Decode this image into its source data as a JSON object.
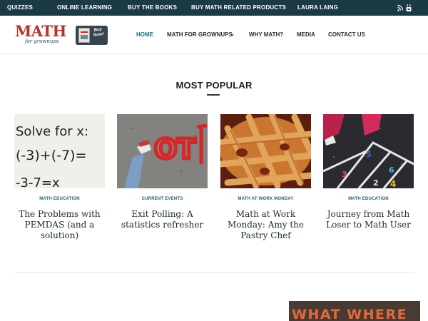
{
  "topbar": {
    "items": [
      "QUIZZES",
      "ONLINE LEARNING",
      "BUY THE BOOKS",
      "BUY MATH RELATED PRODUCTS",
      "LAURA LAING"
    ],
    "social_icons": [
      "rss-icon",
      "youtube-icon"
    ]
  },
  "header": {
    "logo_main": "MATH",
    "logo_sub": "for grownups",
    "book_badge": {
      "book_title": "Math for Grownups",
      "cta": "Buy Now!"
    },
    "nav": [
      "HOME",
      "MATH FOR GROWNUPS",
      "WHY MATH?",
      "MEDIA",
      "CONTACT US"
    ],
    "active_nav": "HOME",
    "dropdown_icon": "chevron-down-icon"
  },
  "section": {
    "title": "MOST POPULAR"
  },
  "posts": [
    {
      "category": "MATH EDUCATION",
      "title": "The Problems with PEMDAS (and a solution)",
      "image": "chalkboard-equation"
    },
    {
      "category": "CURRENT EVENTS",
      "title": "Exit Polling: A statistics refresher",
      "image": "vote-graffiti"
    },
    {
      "category": "MATH AT WORK MONDAY",
      "title": "Math at Work Monday: Amy the Pastry Chef",
      "image": "lattice-pie"
    },
    {
      "category": "MATH EDUCATION",
      "title": "Journey from Math Loser to Math User",
      "image": "hopscotch"
    }
  ],
  "promo": {
    "text": "WHAT WHERE"
  },
  "colors": {
    "topbar": "#1b3a44",
    "logo_red": "#b3332f",
    "active_link": "#1b6f7e",
    "category": "#1b5f6e"
  }
}
